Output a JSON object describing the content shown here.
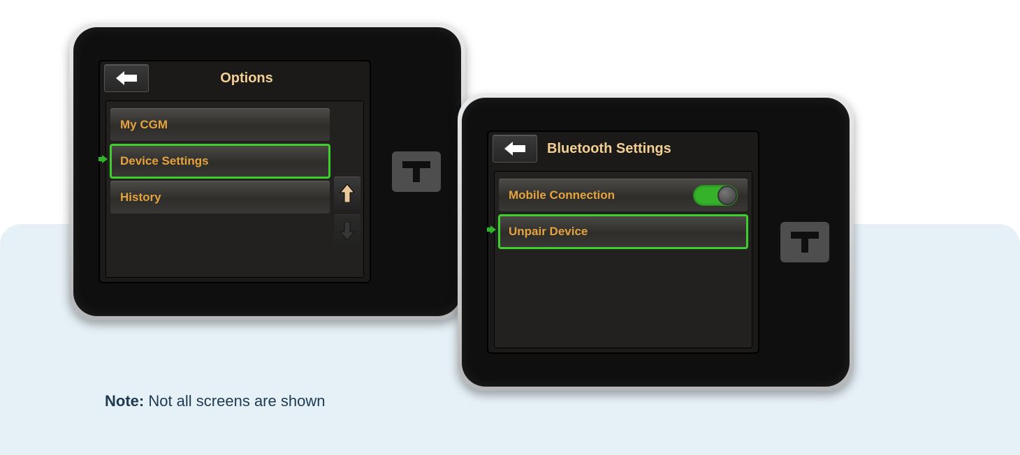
{
  "device1": {
    "title": "Options",
    "items": [
      {
        "label": "My CGM"
      },
      {
        "label": "Device Settings",
        "highlighted": true
      },
      {
        "label": "History"
      }
    ],
    "scroll_up_enabled": true,
    "scroll_down_enabled": false
  },
  "device2": {
    "title": "Bluetooth Settings",
    "items": [
      {
        "label": "Mobile Connection",
        "toggle_on": true
      },
      {
        "label": "Unpair Device",
        "highlighted": true
      }
    ]
  },
  "note": {
    "prefix": "Note:",
    "text": " Not all screens are shown"
  },
  "colors": {
    "accent_text": "#e5a33f",
    "highlight_border": "#3fcf2d",
    "toggle_on": "#35b22a"
  }
}
